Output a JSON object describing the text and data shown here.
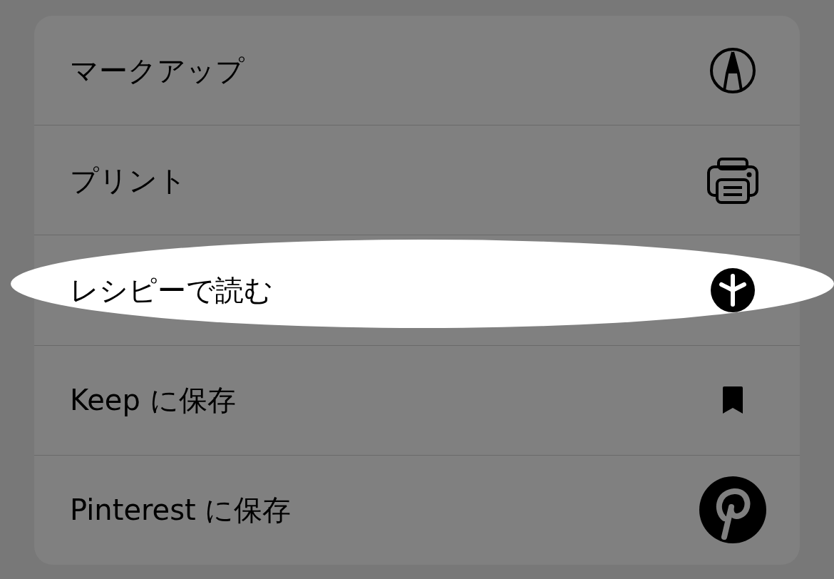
{
  "menu": {
    "items": [
      {
        "kind": "markup",
        "label": "マークアップ",
        "selected": false
      },
      {
        "kind": "print",
        "label": "プリント",
        "selected": false
      },
      {
        "kind": "recipe",
        "label": "レシピーで読む",
        "selected": true
      },
      {
        "kind": "bookmark",
        "label": "Keep に保存",
        "selected": false
      },
      {
        "kind": "pin",
        "label": "Pinterest に保存",
        "selected": false
      }
    ]
  }
}
